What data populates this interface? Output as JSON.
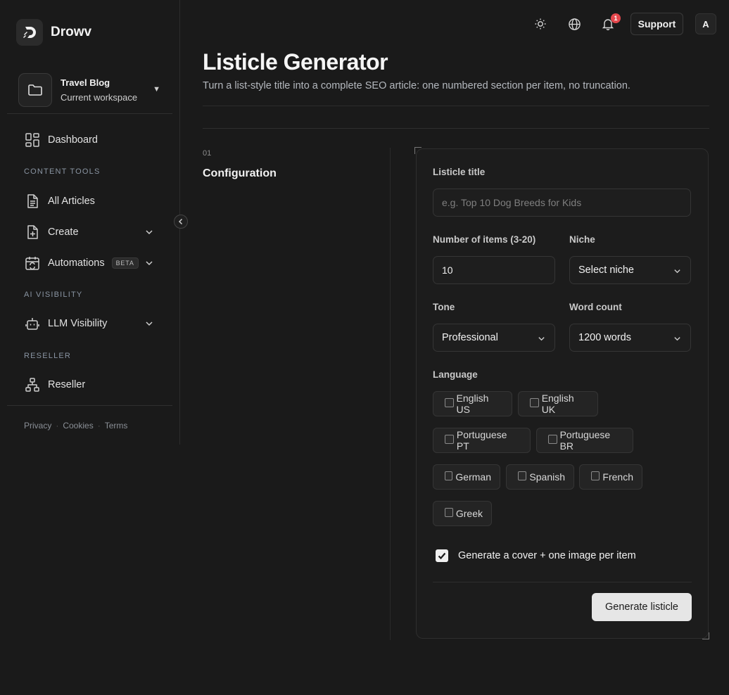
{
  "brand": {
    "name": "Drowv"
  },
  "workspace": {
    "name": "Travel Blog",
    "subtitle": "Current workspace"
  },
  "nav": {
    "dashboard": "Dashboard",
    "content_tools_title": "CONTENT TOOLS",
    "all_articles": "All Articles",
    "create": "Create",
    "automations": "Automations",
    "automations_badge": "BETA",
    "ai_visibility_title": "AI VISIBILITY",
    "llm_visibility": "LLM Visibility",
    "reseller_title": "RESELLER",
    "reseller": "Reseller"
  },
  "footer": {
    "privacy": "Privacy",
    "cookies": "Cookies",
    "terms": "Terms",
    "separator": "·"
  },
  "topbar": {
    "notification_count": "1",
    "support_label": "Support",
    "avatar_initial": "A"
  },
  "page": {
    "title": "Listicle Generator",
    "subtitle": "Turn a list-style title into a complete SEO article: one numbered section per item, no truncation."
  },
  "section": {
    "number": "01",
    "title": "Configuration"
  },
  "form": {
    "title_label": "Listicle title",
    "title_placeholder": "e.g. Top 10 Dog Breeds for Kids",
    "items_label": "Number of items (3-20)",
    "items_value": "10",
    "niche_label": "Niche",
    "niche_value": "Select niche",
    "tone_label": "Tone",
    "tone_value": "Professional",
    "word_count_label": "Word count",
    "word_count_value": "1200 words",
    "language_label": "Language",
    "languages": [
      "English US",
      "English UK",
      "Portuguese PT",
      "Portuguese BR",
      "German",
      "Spanish",
      "French",
      "Greek"
    ],
    "cover_label": "Generate a cover + one image per item",
    "cover_checked": true,
    "submit_label": "Generate listicle"
  }
}
